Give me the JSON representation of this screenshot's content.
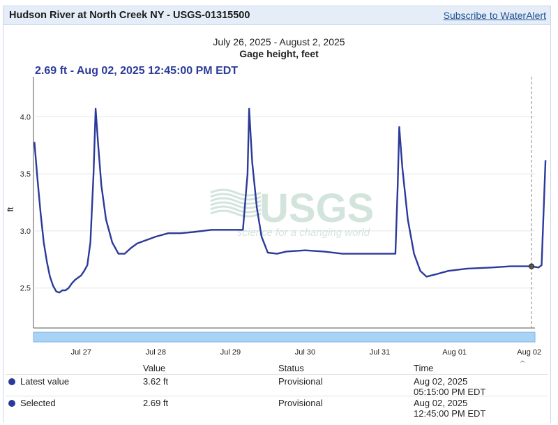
{
  "header": {
    "title": "Hudson River at North Creek NY - USGS-01315500",
    "subscribe_label": "Subscribe to WaterAlert"
  },
  "chart_header": {
    "date_range": "July 26, 2025 - August 2, 2025",
    "parameter": "Gage height, feet",
    "tooltip": "2.69 ft - Aug 02, 2025 12:45:00 PM EDT"
  },
  "watermark": {
    "logo": "USGS",
    "tagline": "science for a changing world"
  },
  "colors": {
    "line": "#2b3a9a",
    "brush": "#a9d3f5",
    "header_bg": "#e5eef8"
  },
  "chart_data": {
    "type": "line",
    "title": "Gage height, feet",
    "ylabel": "ft",
    "xlabel": "",
    "ylim": [
      2.15,
      4.35
    ],
    "yticks": [
      2.5,
      3.0,
      3.5,
      4.0
    ],
    "ytick_labels": [
      "2.5",
      "3.0",
      "3.5",
      "4.0"
    ],
    "xlim_days": [
      0,
      6.715
    ],
    "xtick_labels": [
      "Jul 27",
      "Jul 28",
      "Jul 29",
      "Jul 30",
      "Jul 31",
      "Aug 01",
      "Aug 02"
    ],
    "grid": true,
    "series": [
      {
        "points": [
          [
            "Jul 26 21:00",
            3.78
          ],
          [
            "Jul 26 22:00",
            3.45
          ],
          [
            "Jul 26 23:00",
            3.15
          ],
          [
            "Jul 27 00:00",
            2.9
          ],
          [
            "Jul 27 01:00",
            2.73
          ],
          [
            "Jul 27 02:00",
            2.6
          ],
          [
            "Jul 27 03:00",
            2.52
          ],
          [
            "Jul 27 04:00",
            2.47
          ],
          [
            "Jul 27 05:00",
            2.46
          ],
          [
            "Jul 27 06:00",
            2.48
          ],
          [
            "Jul 27 07:00",
            2.48
          ],
          [
            "Jul 27 08:00",
            2.5
          ],
          [
            "Jul 27 09:00",
            2.54
          ],
          [
            "Jul 27 10:00",
            2.57
          ],
          [
            "Jul 27 11:00",
            2.59
          ],
          [
            "Jul 27 12:00",
            2.61
          ],
          [
            "Jul 27 13:00",
            2.65
          ],
          [
            "Jul 27 14:00",
            2.7
          ],
          [
            "Jul 27 15:00",
            2.9
          ],
          [
            "Jul 27 16:00",
            3.5
          ],
          [
            "Jul 27 16:40",
            4.07
          ],
          [
            "Jul 27 17:30",
            3.75
          ],
          [
            "Jul 27 18:30",
            3.4
          ],
          [
            "Jul 27 20:00",
            3.1
          ],
          [
            "Jul 27 22:00",
            2.9
          ],
          [
            "Jul 28 00:00",
            2.8
          ],
          [
            "Jul 28 02:00",
            2.8
          ],
          [
            "Jul 28 04:00",
            2.85
          ],
          [
            "Jul 28 06:00",
            2.89
          ],
          [
            "Jul 28 09:00",
            2.92
          ],
          [
            "Jul 28 12:00",
            2.95
          ],
          [
            "Jul 28 16:00",
            2.98
          ],
          [
            "Jul 28 20:00",
            2.98
          ],
          [
            "Jul 29 00:00",
            2.99
          ],
          [
            "Jul 29 06:00",
            3.01
          ],
          [
            "Jul 29 12:00",
            3.01
          ],
          [
            "Jul 29 16:00",
            3.01
          ],
          [
            "Jul 29 17:30",
            3.5
          ],
          [
            "Jul 29 18:00",
            4.07
          ],
          [
            "Jul 29 19:00",
            3.6
          ],
          [
            "Jul 29 20:30",
            3.2
          ],
          [
            "Jul 29 22:00",
            2.95
          ],
          [
            "Jul 30 00:00",
            2.81
          ],
          [
            "Jul 30 03:00",
            2.8
          ],
          [
            "Jul 30 06:00",
            2.82
          ],
          [
            "Jul 30 12:00",
            2.83
          ],
          [
            "Jul 30 18:00",
            2.82
          ],
          [
            "Jul 31 00:00",
            2.8
          ],
          [
            "Jul 31 06:00",
            2.8
          ],
          [
            "Jul 31 12:00",
            2.8
          ],
          [
            "Jul 31 17:00",
            2.8
          ],
          [
            "Jul 31 17:45",
            3.4
          ],
          [
            "Jul 31 18:15",
            3.91
          ],
          [
            "Jul 31 19:15",
            3.55
          ],
          [
            "Jul 31 21:00",
            3.1
          ],
          [
            "Jul 31 23:00",
            2.8
          ],
          [
            "Aug 01 01:00",
            2.65
          ],
          [
            "Aug 01 03:00",
            2.6
          ],
          [
            "Aug 01 06:00",
            2.62
          ],
          [
            "Aug 01 10:00",
            2.65
          ],
          [
            "Aug 01 16:00",
            2.67
          ],
          [
            "Aug 02 00:00",
            2.68
          ],
          [
            "Aug 02 06:00",
            2.69
          ],
          [
            "Aug 02 12:45",
            2.69
          ],
          [
            "Aug 02 15:00",
            2.68
          ],
          [
            "Aug 02 16:00",
            2.7
          ],
          [
            "Aug 02 17:15",
            3.62
          ]
        ]
      }
    ],
    "selected_point": [
      "Aug 02 12:45",
      2.69
    ]
  },
  "info_table": {
    "headers": {
      "value": "Value",
      "status": "Status",
      "time": "Time"
    },
    "rows": [
      {
        "label": "Latest value",
        "value": "3.62 ft",
        "status": "Provisional",
        "time_date": "Aug 02, 2025",
        "time_clock": "05:15:00 PM EDT"
      },
      {
        "label": "Selected",
        "value": "2.69 ft",
        "status": "Provisional",
        "time_date": "Aug 02, 2025",
        "time_clock": "12:45:00 PM EDT"
      }
    ]
  }
}
